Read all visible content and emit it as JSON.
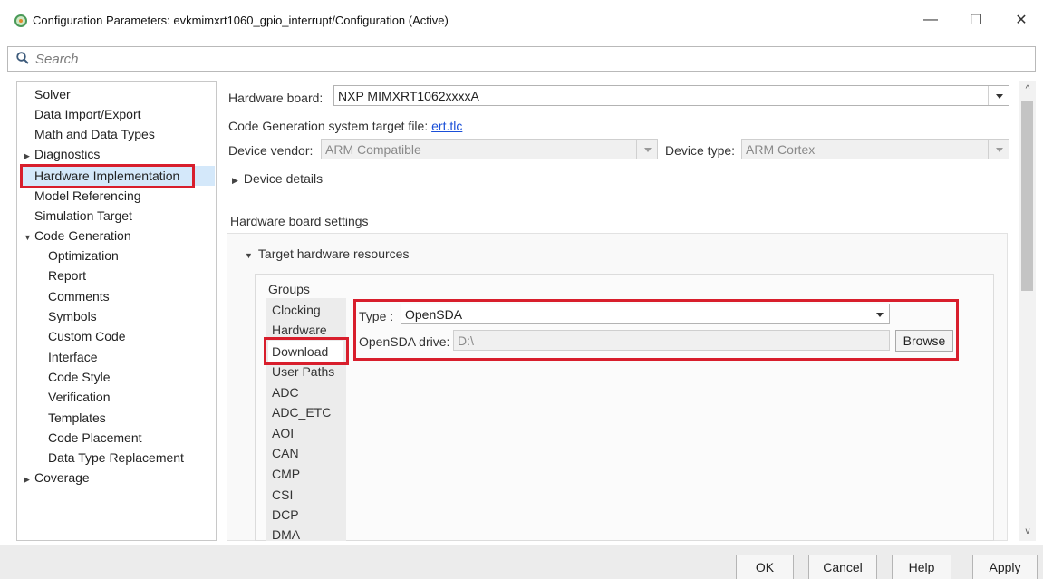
{
  "window": {
    "title": "Configuration Parameters: evkmimxrt1060_gpio_interrupt/Configuration (Active)",
    "minimize": "—",
    "maximize": "☐",
    "close": "✕"
  },
  "search": {
    "placeholder": "Search",
    "value": ""
  },
  "nav": {
    "items": [
      {
        "label": "Solver"
      },
      {
        "label": "Data Import/Export"
      },
      {
        "label": "Math and Data Types"
      },
      {
        "label": "Diagnostics",
        "caret": "▶"
      },
      {
        "label": "Hardware Implementation"
      },
      {
        "label": "Model Referencing"
      },
      {
        "label": "Simulation Target"
      },
      {
        "label": "Code Generation",
        "caret": "▼"
      },
      {
        "label": "Optimization"
      },
      {
        "label": "Report"
      },
      {
        "label": "Comments"
      },
      {
        "label": "Symbols"
      },
      {
        "label": "Custom Code"
      },
      {
        "label": "Interface"
      },
      {
        "label": "Code Style"
      },
      {
        "label": "Verification"
      },
      {
        "label": "Templates"
      },
      {
        "label": "Code Placement"
      },
      {
        "label": "Data Type Replacement"
      },
      {
        "label": "Coverage",
        "caret": "▶"
      }
    ],
    "selected": "Hardware Implementation"
  },
  "form": {
    "hardware_board_label": "Hardware board:",
    "hardware_board_value": "NXP MIMXRT1062xxxxA",
    "target_file_label": "Code Generation system target file:",
    "target_file_link": "ert.tlc",
    "device_vendor_label": "Device vendor:",
    "device_vendor_value": "ARM Compatible",
    "device_type_label": "Device type:",
    "device_type_value": "ARM Cortex",
    "device_details_label": "Device details",
    "device_details_caret": "▶",
    "board_settings_label": "Hardware board settings",
    "target_resources_label": "Target hardware resources",
    "target_resources_caret": "▼"
  },
  "groups": {
    "title": "Groups",
    "items": [
      "Clocking",
      "Hardware",
      "Download",
      "User Paths",
      "ADC",
      "ADC_ETC",
      "AOI",
      "CAN",
      "CMP",
      "CSI",
      "DCP",
      "DMA"
    ],
    "selected": "Download"
  },
  "download": {
    "type_label": "Type :",
    "type_value": "OpenSDA",
    "drive_label": "OpenSDA drive:",
    "drive_value": "D:\\",
    "browse_label": "Browse"
  },
  "footer": {
    "ok": "OK",
    "cancel": "Cancel",
    "help": "Help",
    "apply": "Apply"
  },
  "colors": {
    "highlight_red": "#d81e2c",
    "selection_blue": "#d4e8fa",
    "link_blue": "#1a4fd8"
  }
}
